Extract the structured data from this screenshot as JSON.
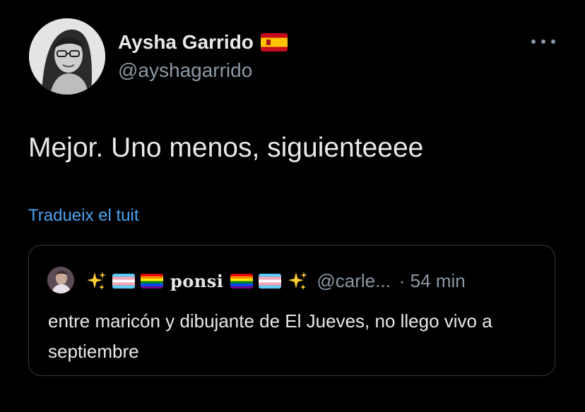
{
  "author": {
    "name": "Aysha Garrido",
    "handle": "@ayshagarrido",
    "flag_icon": "spain-flag-icon"
  },
  "tweet": {
    "text": "Mejor. Uno menos, siguienteeee",
    "translate_label": "Tradueix el tuit"
  },
  "quoted": {
    "display_name": "ponsi",
    "handle": "@carle...",
    "time": "· 54 min",
    "text": "entre maricón y dibujante de El Jueves, no llego vivo a septiembre",
    "name_icons": [
      "sparkles-icon",
      "trans-flag-icon",
      "rainbow-flag-icon",
      "rainbow-flag-icon",
      "trans-flag-icon",
      "sparkles-icon"
    ]
  },
  "colors": {
    "background": "#000000",
    "text_primary": "#e7e9ea",
    "text_secondary": "#8b98a5",
    "link": "#4aa3f0",
    "border": "#333639"
  }
}
